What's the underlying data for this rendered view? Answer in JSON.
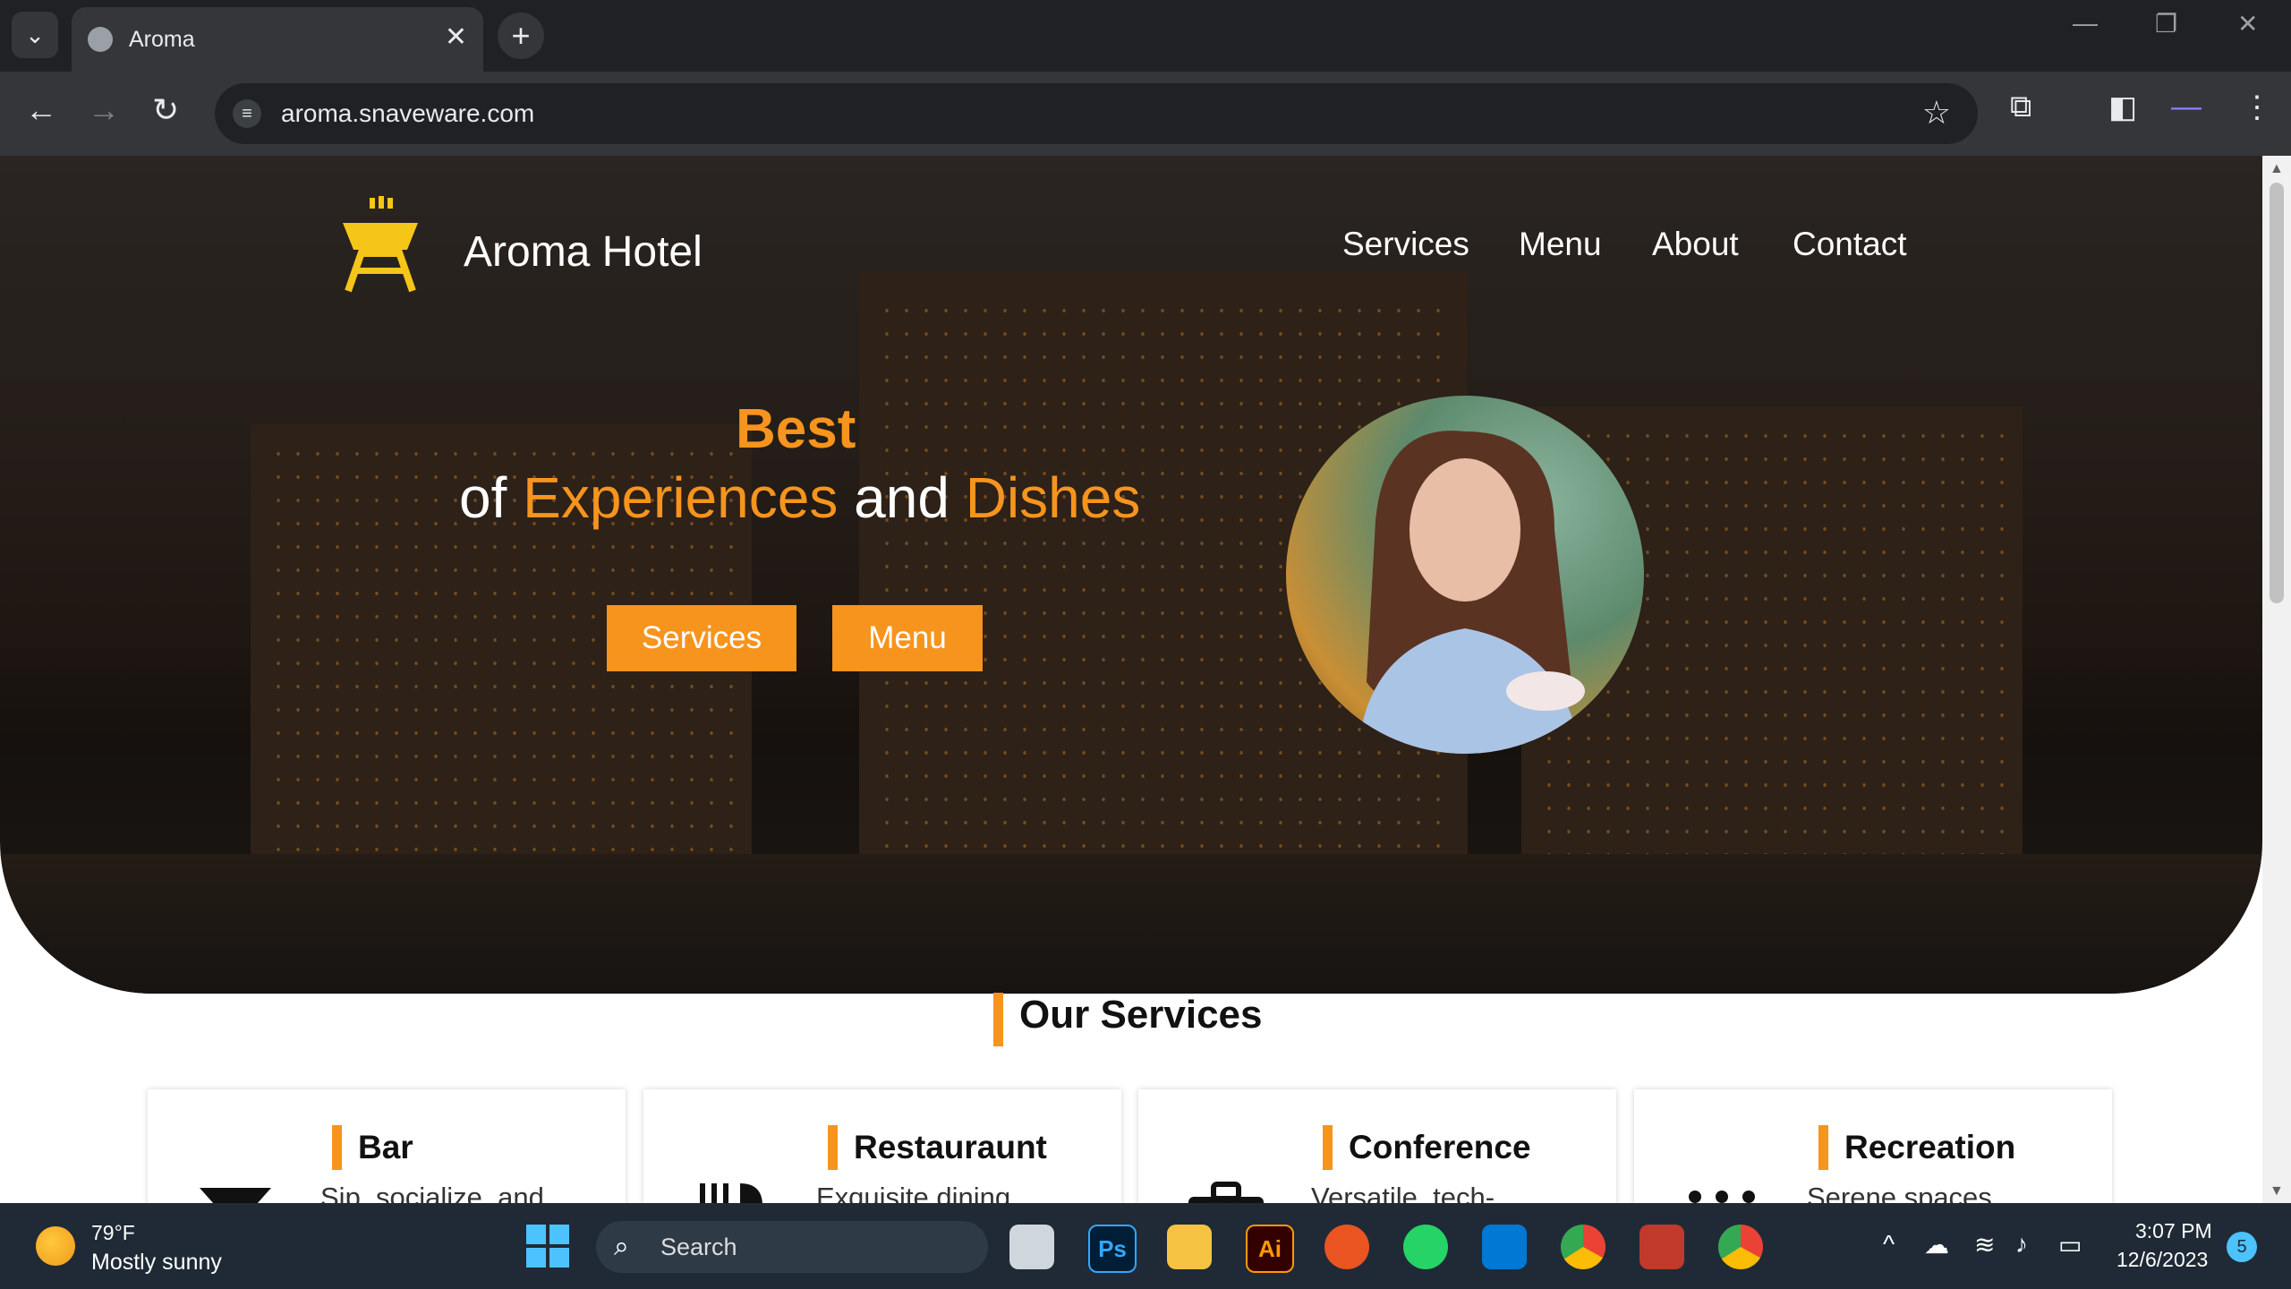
{
  "browser": {
    "tab_title": "Aroma",
    "url": "aroma.snaveware.com"
  },
  "site": {
    "brand": "Aroma Hotel",
    "nav": [
      "Services",
      "Menu",
      "About",
      "Contact"
    ],
    "hero": {
      "best": "Best",
      "line_of": "of",
      "experiences": "Experiences",
      "and": "and",
      "dishes": "Dishes"
    },
    "buttons": {
      "services": "Services",
      "menu": "Menu"
    },
    "section_title": "Our Services",
    "cards": [
      {
        "title": "Bar",
        "desc": "Sip, socialize, and"
      },
      {
        "title": "Restauraunt",
        "desc": "Exquisite dining"
      },
      {
        "title": "Conference",
        "desc": "Versatile, tech-"
      },
      {
        "title": "Recreation",
        "desc": "Serene spaces"
      }
    ],
    "accent_color": "#f7941d"
  },
  "taskbar": {
    "temperature": "79°F",
    "weather": "Mostly sunny",
    "search": "Search",
    "time": "3:07 PM",
    "date": "12/6/2023",
    "notifications": "5",
    "apps": [
      "Ps",
      "Ai"
    ]
  }
}
